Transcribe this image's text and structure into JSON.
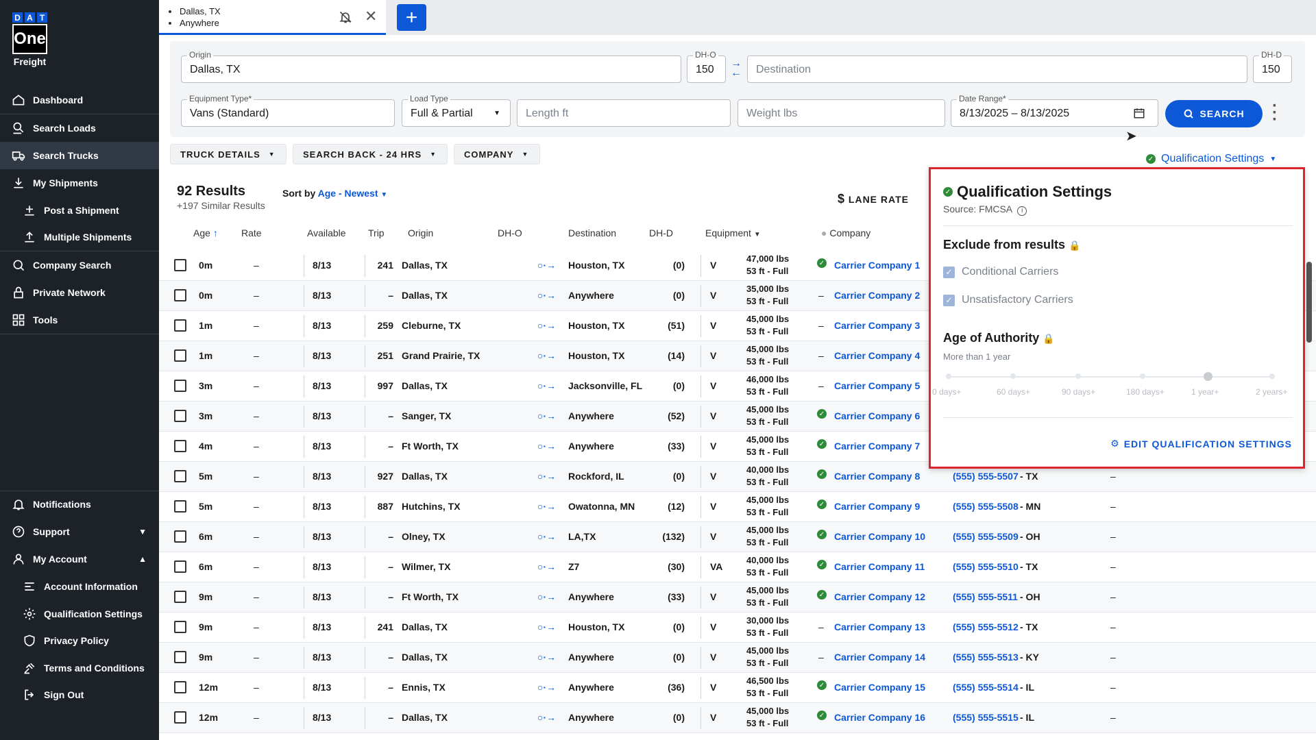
{
  "sidebar": {
    "logo": {
      "letters": [
        "D",
        "A",
        "T"
      ],
      "one": "One",
      "freight": "Freight"
    },
    "items": [
      {
        "label": "Dashboard",
        "icon": "home-icon"
      },
      {
        "label": "Search Loads",
        "icon": "search-loads-icon"
      },
      {
        "label": "Search Trucks",
        "icon": "truck-icon"
      },
      {
        "label": "My Shipments",
        "icon": "download-icon"
      },
      {
        "label": "Post a Shipment",
        "icon": "post-icon"
      },
      {
        "label": "Multiple Shipments",
        "icon": "upload-icon"
      },
      {
        "label": "Company Search",
        "icon": "company-search-icon"
      },
      {
        "label": "Private Network",
        "icon": "lock-icon"
      },
      {
        "label": "Tools",
        "icon": "grid-icon"
      }
    ],
    "bottom": [
      {
        "label": "Notifications",
        "icon": "bell-icon"
      },
      {
        "label": "Support",
        "icon": "help-icon"
      },
      {
        "label": "My Account",
        "icon": "account-icon"
      },
      {
        "label": "Account Information",
        "icon": "list-icon"
      },
      {
        "label": "Qualification Settings",
        "icon": "gear-icon"
      },
      {
        "label": "Privacy Policy",
        "icon": "shield-icon"
      },
      {
        "label": "Terms and Conditions",
        "icon": "gavel-icon"
      },
      {
        "label": "Sign Out",
        "icon": "sign-out-icon"
      }
    ]
  },
  "tab": {
    "line1": "Dallas, TX",
    "line2": "Anywhere",
    "add": "+"
  },
  "form": {
    "origin_label": "Origin",
    "origin_value": "Dallas, TX",
    "dho_label": "DH-O",
    "dho_value": "150",
    "destination_placeholder": "Destination",
    "dhd_label": "DH-D",
    "dhd_value": "150",
    "equipment_label": "Equipment Type*",
    "equipment_value": "Vans (Standard)",
    "loadtype_label": "Load Type",
    "loadtype_value": "Full & Partial",
    "length_placeholder": "Length ft",
    "weight_placeholder": "Weight lbs",
    "daterange_label": "Date Range*",
    "daterange_value": "8/13/2025 – 8/13/2025",
    "search_label": "SEARCH"
  },
  "filters": {
    "truck": "TRUCK DETAILS",
    "searchback": "SEARCH BACK - 24 HRS",
    "company": "COMPANY",
    "qualification": "Qualification Settings"
  },
  "results": {
    "count": "92 Results",
    "similar": "+197 Similar Results",
    "sort_label": "Sort by",
    "sort_value": "Age - Newest",
    "lane_rate": "LANE RATE"
  },
  "columns": {
    "age": "Age",
    "rate": "Rate",
    "available": "Available",
    "trip": "Trip",
    "origin": "Origin",
    "dho": "DH-O",
    "destination": "Destination",
    "dhd": "DH-D",
    "equipment": "Equipment",
    "company": "Company"
  },
  "rows": [
    {
      "age": "0m",
      "rate": "–",
      "avail": "8/13",
      "trip": "241",
      "origin": "Dallas, TX",
      "dho": "(0)",
      "dest": "Houston, TX",
      "eq": "V",
      "lbs": "47,000 lbs",
      "len": "53 ft - Full",
      "q": true,
      "company": "Carrier Company 1",
      "phone": "",
      "state": "",
      "last": ""
    },
    {
      "age": "0m",
      "rate": "–",
      "avail": "8/13",
      "trip": "–",
      "origin": "Dallas, TX",
      "dho": "(0)",
      "dest": "Anywhere",
      "eq": "V",
      "lbs": "35,000 lbs",
      "len": "53 ft - Full",
      "q": false,
      "company": "Carrier Company 2",
      "phone": "",
      "state": "",
      "last": ""
    },
    {
      "age": "1m",
      "rate": "–",
      "avail": "8/13",
      "trip": "259",
      "origin": "Cleburne, TX",
      "dho": "(51)",
      "dest": "Houston, TX",
      "eq": "V",
      "lbs": "45,000 lbs",
      "len": "53 ft - Full",
      "q": false,
      "company": "Carrier Company 3",
      "phone": "",
      "state": "",
      "last": ""
    },
    {
      "age": "1m",
      "rate": "–",
      "avail": "8/13",
      "trip": "251",
      "origin": "Grand Prairie, TX",
      "dho": "(14)",
      "dest": "Houston, TX",
      "eq": "V",
      "lbs": "45,000 lbs",
      "len": "53 ft - Full",
      "q": false,
      "company": "Carrier Company 4",
      "phone": "",
      "state": "",
      "last": ""
    },
    {
      "age": "3m",
      "rate": "–",
      "avail": "8/13",
      "trip": "997",
      "origin": "Dallas, TX",
      "dho": "(0)",
      "dest": "Jacksonville, FL",
      "eq": "V",
      "lbs": "46,000 lbs",
      "len": "53 ft - Full",
      "q": false,
      "company": "Carrier Company 5",
      "phone": "",
      "state": "",
      "last": ""
    },
    {
      "age": "3m",
      "rate": "–",
      "avail": "8/13",
      "trip": "–",
      "origin": "Sanger, TX",
      "dho": "(52)",
      "dest": "Anywhere",
      "eq": "V",
      "lbs": "45,000 lbs",
      "len": "53 ft - Full",
      "q": true,
      "company": "Carrier Company 6",
      "phone": "",
      "state": "",
      "last": ""
    },
    {
      "age": "4m",
      "rate": "–",
      "avail": "8/13",
      "trip": "–",
      "origin": "Ft Worth, TX",
      "dho": "(33)",
      "dest": "Anywhere",
      "eq": "V",
      "lbs": "45,000 lbs",
      "len": "53 ft - Full",
      "q": true,
      "company": "Carrier Company 7",
      "phone": "",
      "state": "",
      "last": ""
    },
    {
      "age": "5m",
      "rate": "–",
      "avail": "8/13",
      "trip": "927",
      "origin": "Dallas, TX",
      "dho": "(0)",
      "dest": "Rockford, IL",
      "eq": "V",
      "lbs": "40,000 lbs",
      "len": "53 ft - Full",
      "q": true,
      "company": "Carrier Company 8",
      "phone": "(555) 555-5507",
      "state": "- TX",
      "last": "–"
    },
    {
      "age": "5m",
      "rate": "–",
      "avail": "8/13",
      "trip": "887",
      "origin": "Hutchins, TX",
      "dho": "(12)",
      "dest": "Owatonna, MN",
      "eq": "V",
      "lbs": "45,000 lbs",
      "len": "53 ft - Full",
      "q": true,
      "company": "Carrier Company 9",
      "phone": "(555) 555-5508",
      "state": "- MN",
      "last": "–"
    },
    {
      "age": "6m",
      "rate": "–",
      "avail": "8/13",
      "trip": "–",
      "origin": "Olney, TX",
      "dho": "(132)",
      "dest": "LA,TX",
      "eq": "V",
      "lbs": "45,000 lbs",
      "len": "53 ft - Full",
      "q": true,
      "company": "Carrier Company 10",
      "phone": "(555) 555-5509",
      "state": "- OH",
      "last": "–"
    },
    {
      "age": "6m",
      "rate": "–",
      "avail": "8/13",
      "trip": "–",
      "origin": "Wilmer, TX",
      "dho": "(30)",
      "dest": "Z7",
      "eq": "VA",
      "lbs": "40,000 lbs",
      "len": "53 ft - Full",
      "q": true,
      "company": "Carrier Company 11",
      "phone": "(555) 555-5510",
      "state": "- TX",
      "last": "–"
    },
    {
      "age": "9m",
      "rate": "–",
      "avail": "8/13",
      "trip": "–",
      "origin": "Ft Worth, TX",
      "dho": "(33)",
      "dest": "Anywhere",
      "eq": "V",
      "lbs": "45,000 lbs",
      "len": "53 ft - Full",
      "q": true,
      "company": "Carrier Company 12",
      "phone": "(555) 555-5511",
      "state": "- OH",
      "last": "–"
    },
    {
      "age": "9m",
      "rate": "–",
      "avail": "8/13",
      "trip": "241",
      "origin": "Dallas, TX",
      "dho": "(0)",
      "dest": "Houston, TX",
      "eq": "V",
      "lbs": "30,000 lbs",
      "len": "53 ft - Full",
      "q": false,
      "company": "Carrier Company 13",
      "phone": "(555) 555-5512",
      "state": "- TX",
      "last": "–"
    },
    {
      "age": "9m",
      "rate": "–",
      "avail": "8/13",
      "trip": "–",
      "origin": "Dallas, TX",
      "dho": "(0)",
      "dest": "Anywhere",
      "eq": "V",
      "lbs": "45,000 lbs",
      "len": "53 ft - Full",
      "q": false,
      "company": "Carrier Company 14",
      "phone": "(555) 555-5513",
      "state": "- KY",
      "last": "–"
    },
    {
      "age": "12m",
      "rate": "–",
      "avail": "8/13",
      "trip": "–",
      "origin": "Ennis, TX",
      "dho": "(36)",
      "dest": "Anywhere",
      "eq": "V",
      "lbs": "46,500 lbs",
      "len": "53 ft - Full",
      "q": true,
      "company": "Carrier Company 15",
      "phone": "(555) 555-5514",
      "state": "- IL",
      "last": "–"
    },
    {
      "age": "12m",
      "rate": "–",
      "avail": "8/13",
      "trip": "–",
      "origin": "Dallas, TX",
      "dho": "(0)",
      "dest": "Anywhere",
      "eq": "V",
      "lbs": "45,000 lbs",
      "len": "53 ft - Full",
      "q": true,
      "company": "Carrier Company 16",
      "phone": "(555) 555-5515",
      "state": "- IL",
      "last": "–"
    }
  ],
  "qualification_panel": {
    "title": "Qualification Settings",
    "source": "Source: FMCSA",
    "exclude_heading": "Exclude from results",
    "options": [
      "Conditional Carriers",
      "Unsatisfactory Carriers"
    ],
    "age_heading": "Age of Authority",
    "age_value": "More than 1 year",
    "slider_labels": [
      "0 days+",
      "60 days+",
      "90 days+",
      "180 days+",
      "1 year+",
      "2 years+"
    ],
    "slider_selected_index": 4,
    "edit_label": "EDIT QUALIFICATION SETTINGS"
  },
  "colors": {
    "accent": "#0c58d6",
    "sidebar": "#1d2229",
    "highlight": "#d9252b",
    "ok": "#2e8b3a"
  }
}
